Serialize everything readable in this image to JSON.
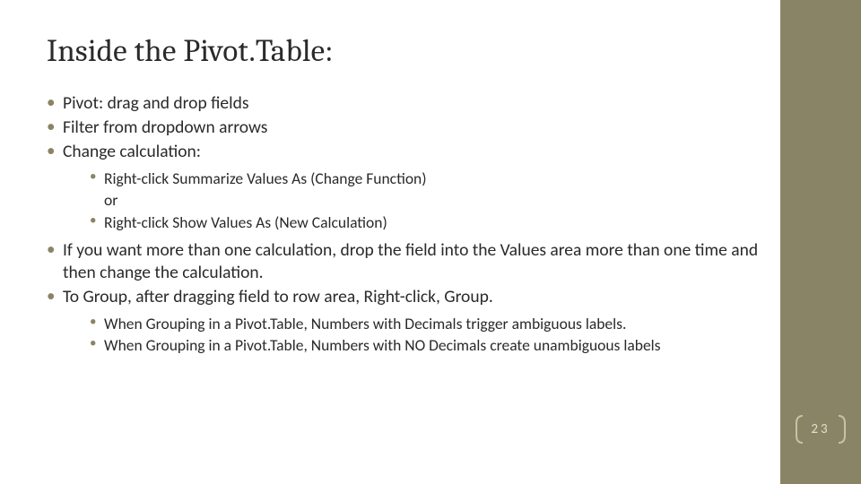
{
  "title": "Inside the Pivot.Table:",
  "bullets": {
    "b1": "Pivot: drag and drop fields",
    "b2": "Filter from dropdown arrows",
    "b3": "Change calculation:",
    "b3_sub": {
      "s1": "Right-click Summarize Values As (Change Function)",
      "or": "or",
      "s2": "Right-click Show Values As (New Calculation)"
    },
    "b4": "If you want more than one calculation, drop the field into the Values area more than one time and then change the calculation.",
    "b5": "To Group, after dragging field to row area, Right-click, Group.",
    "b5_sub": {
      "s1": "When Grouping in a Pivot.Table, Numbers with Decimals trigger ambiguous labels.",
      "s2": "When Grouping in a Pivot.Table, Numbers with NO Decimals create unambiguous labels"
    }
  },
  "page_number": "23"
}
